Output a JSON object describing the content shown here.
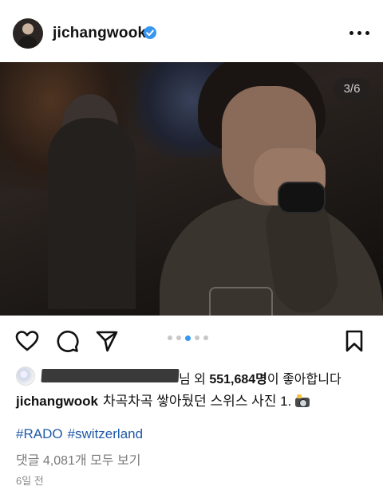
{
  "header": {
    "username": "jichangwook",
    "verified": true,
    "more_icon": "more-horizontal-icon"
  },
  "photo": {
    "counter": "3/6",
    "carousel": {
      "total": 5,
      "active_index": 2
    }
  },
  "actions": {
    "like_icon": "heart-icon",
    "comment_icon": "comment-icon",
    "share_icon": "send-icon",
    "save_icon": "bookmark-icon"
  },
  "likes": {
    "suffix_before": "님 외 ",
    "count": "551,684명",
    "suffix_after": "이 좋아합니다"
  },
  "caption": {
    "username": "jichangwook",
    "text": "차곡차곡 쌓아뒀던 스위스 사진 1."
  },
  "hashtags": [
    "#RADO",
    "#switzerland"
  ],
  "comments_link": "댓글 4,081개 모두 보기",
  "timestamp": "6일 전",
  "colors": {
    "accent": "#3797f0",
    "hashtag": "#1f5aa6",
    "muted": "#7a7a7a"
  }
}
